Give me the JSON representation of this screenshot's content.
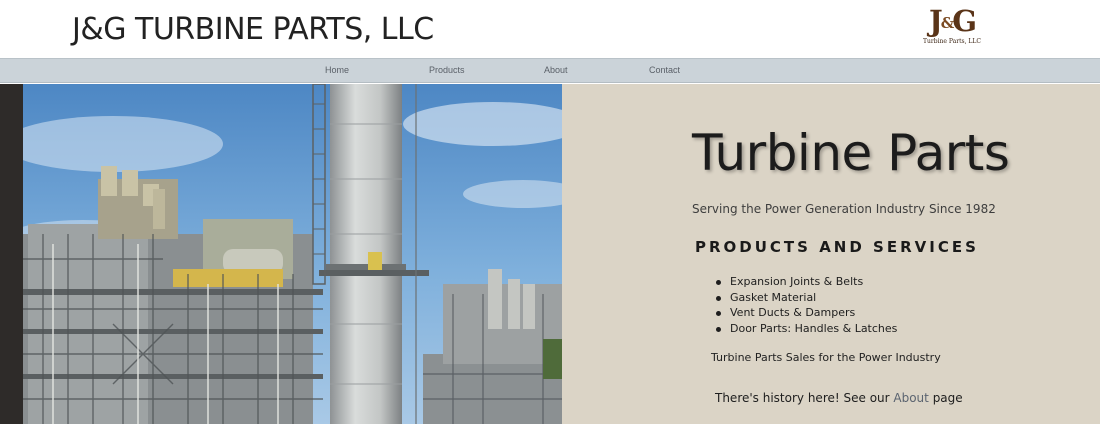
{
  "header": {
    "site_title": "J&G TURBINE PARTS, LLC",
    "logo": {
      "mark": "J&G",
      "mark_j": "J",
      "mark_amp": "&",
      "mark_g": "G",
      "text": "Turbine Parts, LLC"
    }
  },
  "nav": {
    "items": [
      {
        "label": "Home"
      },
      {
        "label": "Products"
      },
      {
        "label": "About"
      },
      {
        "label": "Contact"
      }
    ]
  },
  "hero": {
    "title": "Turbine Parts",
    "tagline": "Serving the Power Generation Industry Since 1982",
    "section_heading": "PRODUCTS AND SERVICES",
    "products": [
      "Expansion Joints & Belts",
      "Gasket Material",
      "Vent Ducts & Dampers",
      "Door Parts: Handles & Latches"
    ],
    "sales_line": "Turbine Parts Sales for the Power Industry",
    "history_prefix": "There's history here!  See our ",
    "history_link": "About",
    "history_suffix": " page"
  },
  "colors": {
    "nav_bar": "#cbd3d9",
    "panel_background": "#dbd4c6",
    "left_strip": "#2e2b29",
    "logo_brown": "#5a3418",
    "link": "#5b6470"
  },
  "icons": [
    "power-plant-photo",
    "company-logo"
  ]
}
